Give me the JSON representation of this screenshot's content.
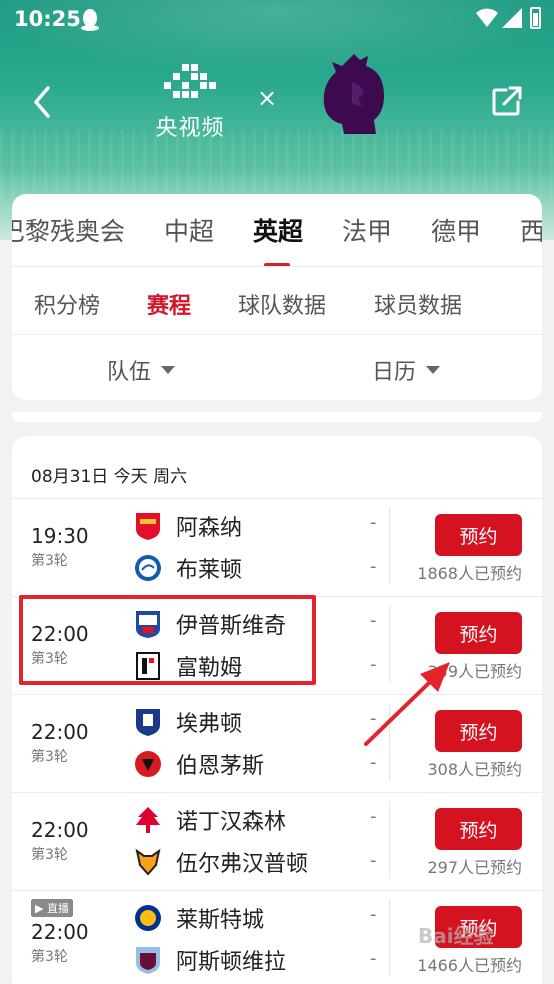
{
  "status_bar": {
    "time": "10:25"
  },
  "header": {
    "logo_text": "央视频",
    "times_sign": "×"
  },
  "league_tabs": [
    {
      "label": "巴黎残奥会"
    },
    {
      "label": "中超"
    },
    {
      "label": "英超"
    },
    {
      "label": "法甲"
    },
    {
      "label": "德甲"
    },
    {
      "label": "西"
    }
  ],
  "sub_tabs": [
    {
      "label": "积分榜"
    },
    {
      "label": "赛程"
    },
    {
      "label": "球队数据"
    },
    {
      "label": "球员数据"
    }
  ],
  "filters": {
    "team": "队伍",
    "calendar": "日历"
  },
  "date_header": "08月31日 今天 周六",
  "matches": [
    {
      "time": "19:30",
      "round": "第3轮",
      "home": "阿森纳",
      "away": "布莱顿",
      "home_score": "-",
      "away_score": "-",
      "button": "预约",
      "count": "1868人已预约",
      "live": ""
    },
    {
      "time": "22:00",
      "round": "第3轮",
      "home": "伊普斯维奇",
      "away": "富勒姆",
      "home_score": "-",
      "away_score": "-",
      "button": "预约",
      "count": "339人已预约",
      "live": ""
    },
    {
      "time": "22:00",
      "round": "第3轮",
      "home": "埃弗顿",
      "away": "伯恩茅斯",
      "home_score": "-",
      "away_score": "-",
      "button": "预约",
      "count": "308人已预约",
      "live": ""
    },
    {
      "time": "22:00",
      "round": "第3轮",
      "home": "诺丁汉森林",
      "away": "伍尔弗汉普顿",
      "home_score": "-",
      "away_score": "-",
      "button": "预约",
      "count": "297人已预约",
      "live": ""
    },
    {
      "time": "22:00",
      "round": "第3轮",
      "home": "莱斯特城",
      "away": "阿斯顿维拉",
      "home_score": "-",
      "away_score": "-",
      "button": "预约",
      "count": "1466人已预约",
      "live": "▶ 直播"
    }
  ],
  "watermark": "Bai经验",
  "colors": {
    "accent": "#d5121f",
    "header_green": "#2aa98e"
  }
}
